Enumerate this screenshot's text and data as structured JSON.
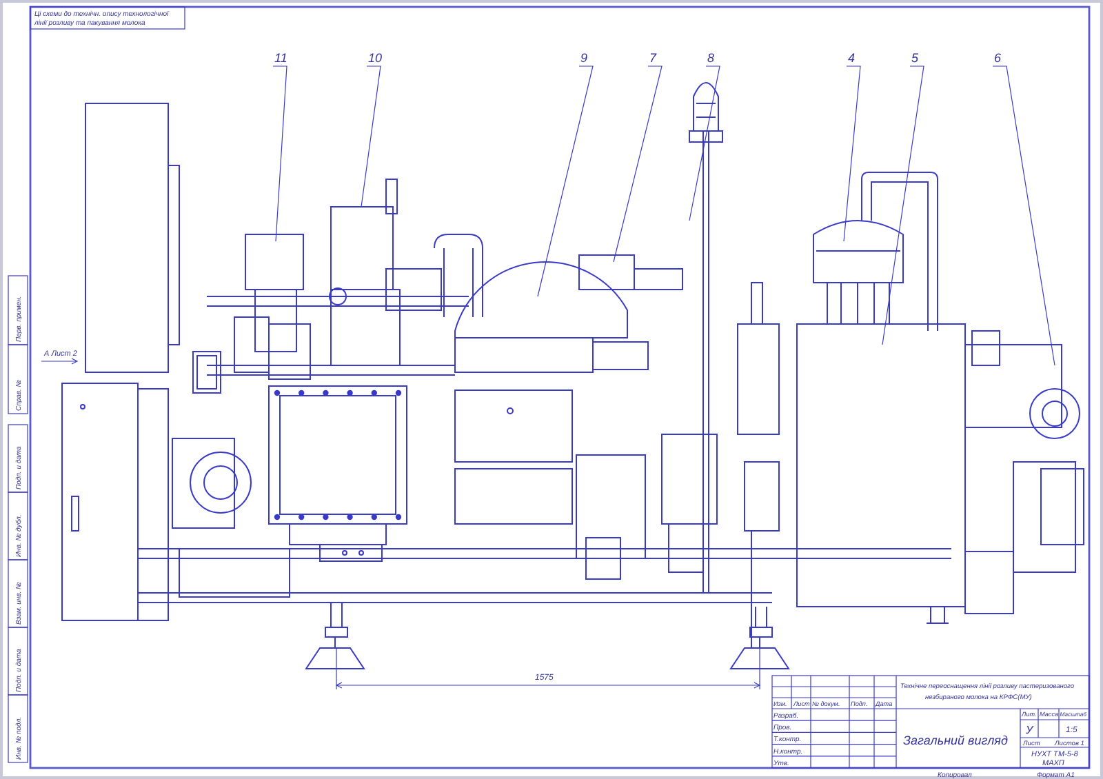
{
  "stamp": {
    "lines": [
      "Ці схеми до технічн. опису технологічної",
      "лінії розливу та пакування молока"
    ]
  },
  "view_marker": "А Лист 2",
  "callouts": [
    "11",
    "10",
    "9",
    "7",
    "8",
    "4",
    "5",
    "6"
  ],
  "dimension": "1575",
  "side_stamp": {
    "upper": [
      "Перв. примен.",
      "Справ. №"
    ],
    "lower": [
      "Подп. и дата",
      "Инв. № дубл.",
      "Взам. инв. №",
      "Подп. и дата",
      "Инв. № подл."
    ]
  },
  "title_block": {
    "project": [
      "Технічне переоснащення лінії розливу пастеризованого",
      "незбираного молока на КРФС(МУ)"
    ],
    "headers": [
      "Изм.",
      "Лист",
      "№ докум.",
      "Подп.",
      "Дата"
    ],
    "roles": [
      "Разраб.",
      "Пров.",
      "Т.контр.",
      "Н.контр.",
      "Утв."
    ],
    "sheet_title": "Загальний вигляд",
    "lit_header": "Лит.",
    "mass_header": "Масса",
    "scale_header": "Масштаб",
    "lit": "У",
    "scale": "1:5",
    "sheet": "Лист",
    "sheets": "Листов 1",
    "org": [
      "НУХТ ТМ-5-8",
      "МАХП"
    ]
  },
  "footer": {
    "copied": "Копировал",
    "format": "Формат А1"
  }
}
